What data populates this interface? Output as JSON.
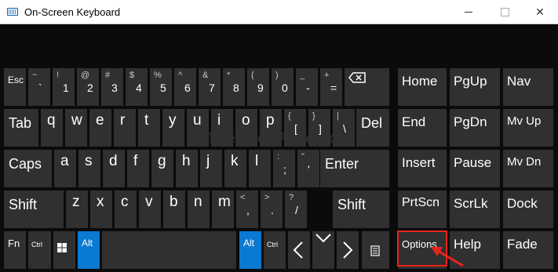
{
  "window": {
    "title": "On-Screen Keyboard",
    "controls": {
      "minimize": "—",
      "maximize": "☐",
      "close": "✕"
    }
  },
  "watermark": "©TheGeekPage.com",
  "keys": {
    "esc": "Esc",
    "row1": [
      {
        "top": "~",
        "bot": "`"
      },
      {
        "top": "!",
        "bot": "1"
      },
      {
        "top": "@",
        "bot": "2"
      },
      {
        "top": "#",
        "bot": "3"
      },
      {
        "top": "$",
        "bot": "4"
      },
      {
        "top": "%",
        "bot": "5"
      },
      {
        "top": "^",
        "bot": "6"
      },
      {
        "top": "&",
        "bot": "7"
      },
      {
        "top": "*",
        "bot": "8"
      },
      {
        "top": "(",
        "bot": "9"
      },
      {
        "top": ")",
        "bot": "0"
      },
      {
        "top": "_",
        "bot": "-"
      },
      {
        "top": "+",
        "bot": "="
      }
    ],
    "tab": "Tab",
    "row2_letters": [
      "q",
      "w",
      "e",
      "r",
      "t",
      "y",
      "u",
      "i",
      "o",
      "p"
    ],
    "row2_syms": [
      {
        "top": "{",
        "bot": "["
      },
      {
        "top": "}",
        "bot": "]"
      },
      {
        "top": "|",
        "bot": "\\"
      }
    ],
    "del": "Del",
    "caps": "Caps",
    "row3_letters": [
      "a",
      "s",
      "d",
      "f",
      "g",
      "h",
      "j",
      "k",
      "l"
    ],
    "row3_syms": [
      {
        "top": ":",
        "bot": ";"
      },
      {
        "top": "\"",
        "bot": "'"
      }
    ],
    "enter": "Enter",
    "shift_left": "Shift",
    "row4_letters": [
      "z",
      "x",
      "c",
      "v",
      "b",
      "n",
      "m"
    ],
    "row4_syms": [
      {
        "top": "<",
        "bot": ","
      },
      {
        "top": ">",
        "bot": "."
      },
      {
        "top": "?",
        "bot": "/"
      }
    ],
    "shift_right": "Shift",
    "fn": "Fn",
    "ctrl_left": "Ctrl",
    "alt_left": "Alt",
    "alt_right": "Alt",
    "ctrl_right": "Ctrl",
    "nav": {
      "home": "Home",
      "pgup": "PgUp",
      "navkey": "Nav",
      "end": "End",
      "pgdn": "PgDn",
      "mvup": "Mv Up",
      "insert": "Insert",
      "pause": "Pause",
      "mvdn": "Mv Dn",
      "prtscn": "PrtScn",
      "scrlk": "ScrLk",
      "dock": "Dock",
      "options": "Options",
      "help": "Help",
      "fade": "Fade"
    }
  },
  "colors": {
    "key_bg": "#303030",
    "accent": "#0a79d1",
    "highlight": "#e8231c"
  }
}
